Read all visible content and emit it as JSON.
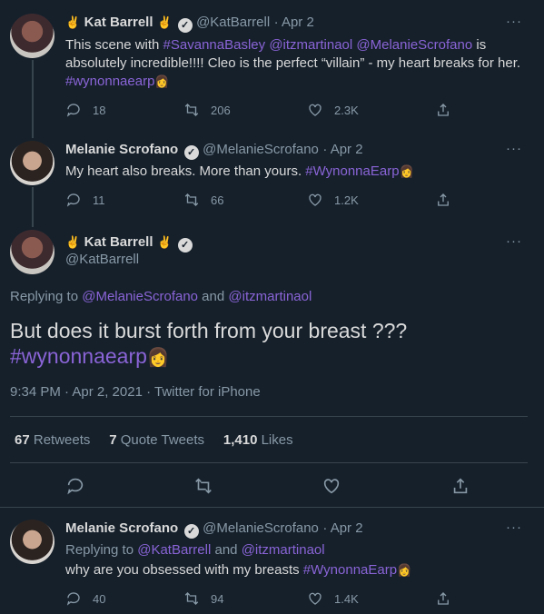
{
  "tweets": [
    {
      "name": "Kat Barrell",
      "hand_left": "✌",
      "hand_right": "✌",
      "handle": "@KatBarrell",
      "date": "· Apr 2",
      "text_parts": [
        "This scene with ",
        "#SavannaBasley",
        " ",
        "@itzmartinaol",
        " ",
        "@MelanieScrofano",
        " is absolutely incredible!!!! Cleo is the perfect “villain” - my heart breaks for her. ",
        "#wynonnaearp"
      ],
      "replies": "18",
      "retweets": "206",
      "likes": "2.3K"
    },
    {
      "name": "Melanie Scrofano",
      "handle": "@MelanieScrofano",
      "date": "· Apr 2",
      "text_parts": [
        "My heart also breaks. More than yours. ",
        "#WynonnaEarp"
      ],
      "replies": "11",
      "retweets": "66",
      "likes": "1.2K"
    }
  ],
  "main": {
    "name": "Kat Barrell",
    "handle": "@KatBarrell",
    "replying_prefix": "Replying to ",
    "replying_user1": "@MelanieScrofano",
    "replying_and": " and ",
    "replying_user2": "@itzmartinaol",
    "text": "But does it burst forth from your breast ???",
    "hashtag": "#wynonnaearp",
    "timestamp": "9:34 PM · Apr 2, 2021 · Twitter for iPhone",
    "retweets_count": "67",
    "retweets_label": "Retweets",
    "quotes_count": "7",
    "quotes_label": "Quote Tweets",
    "likes_count": "1,410",
    "likes_label": "Likes"
  },
  "reply": {
    "name": "Melanie Scrofano",
    "handle": "@MelanieScrofano",
    "date": "· Apr 2",
    "replying_prefix": "Replying to ",
    "replying_user1": "@KatBarrell",
    "replying_and": " and ",
    "replying_user2": "@itzmartinaol",
    "text": "why are you obsessed with my breasts ",
    "hashtag": "#WynonnaEarp",
    "replies": "40",
    "retweets": "94",
    "likes": "1.4K"
  },
  "more_label": "···",
  "verified_mark": "✓"
}
